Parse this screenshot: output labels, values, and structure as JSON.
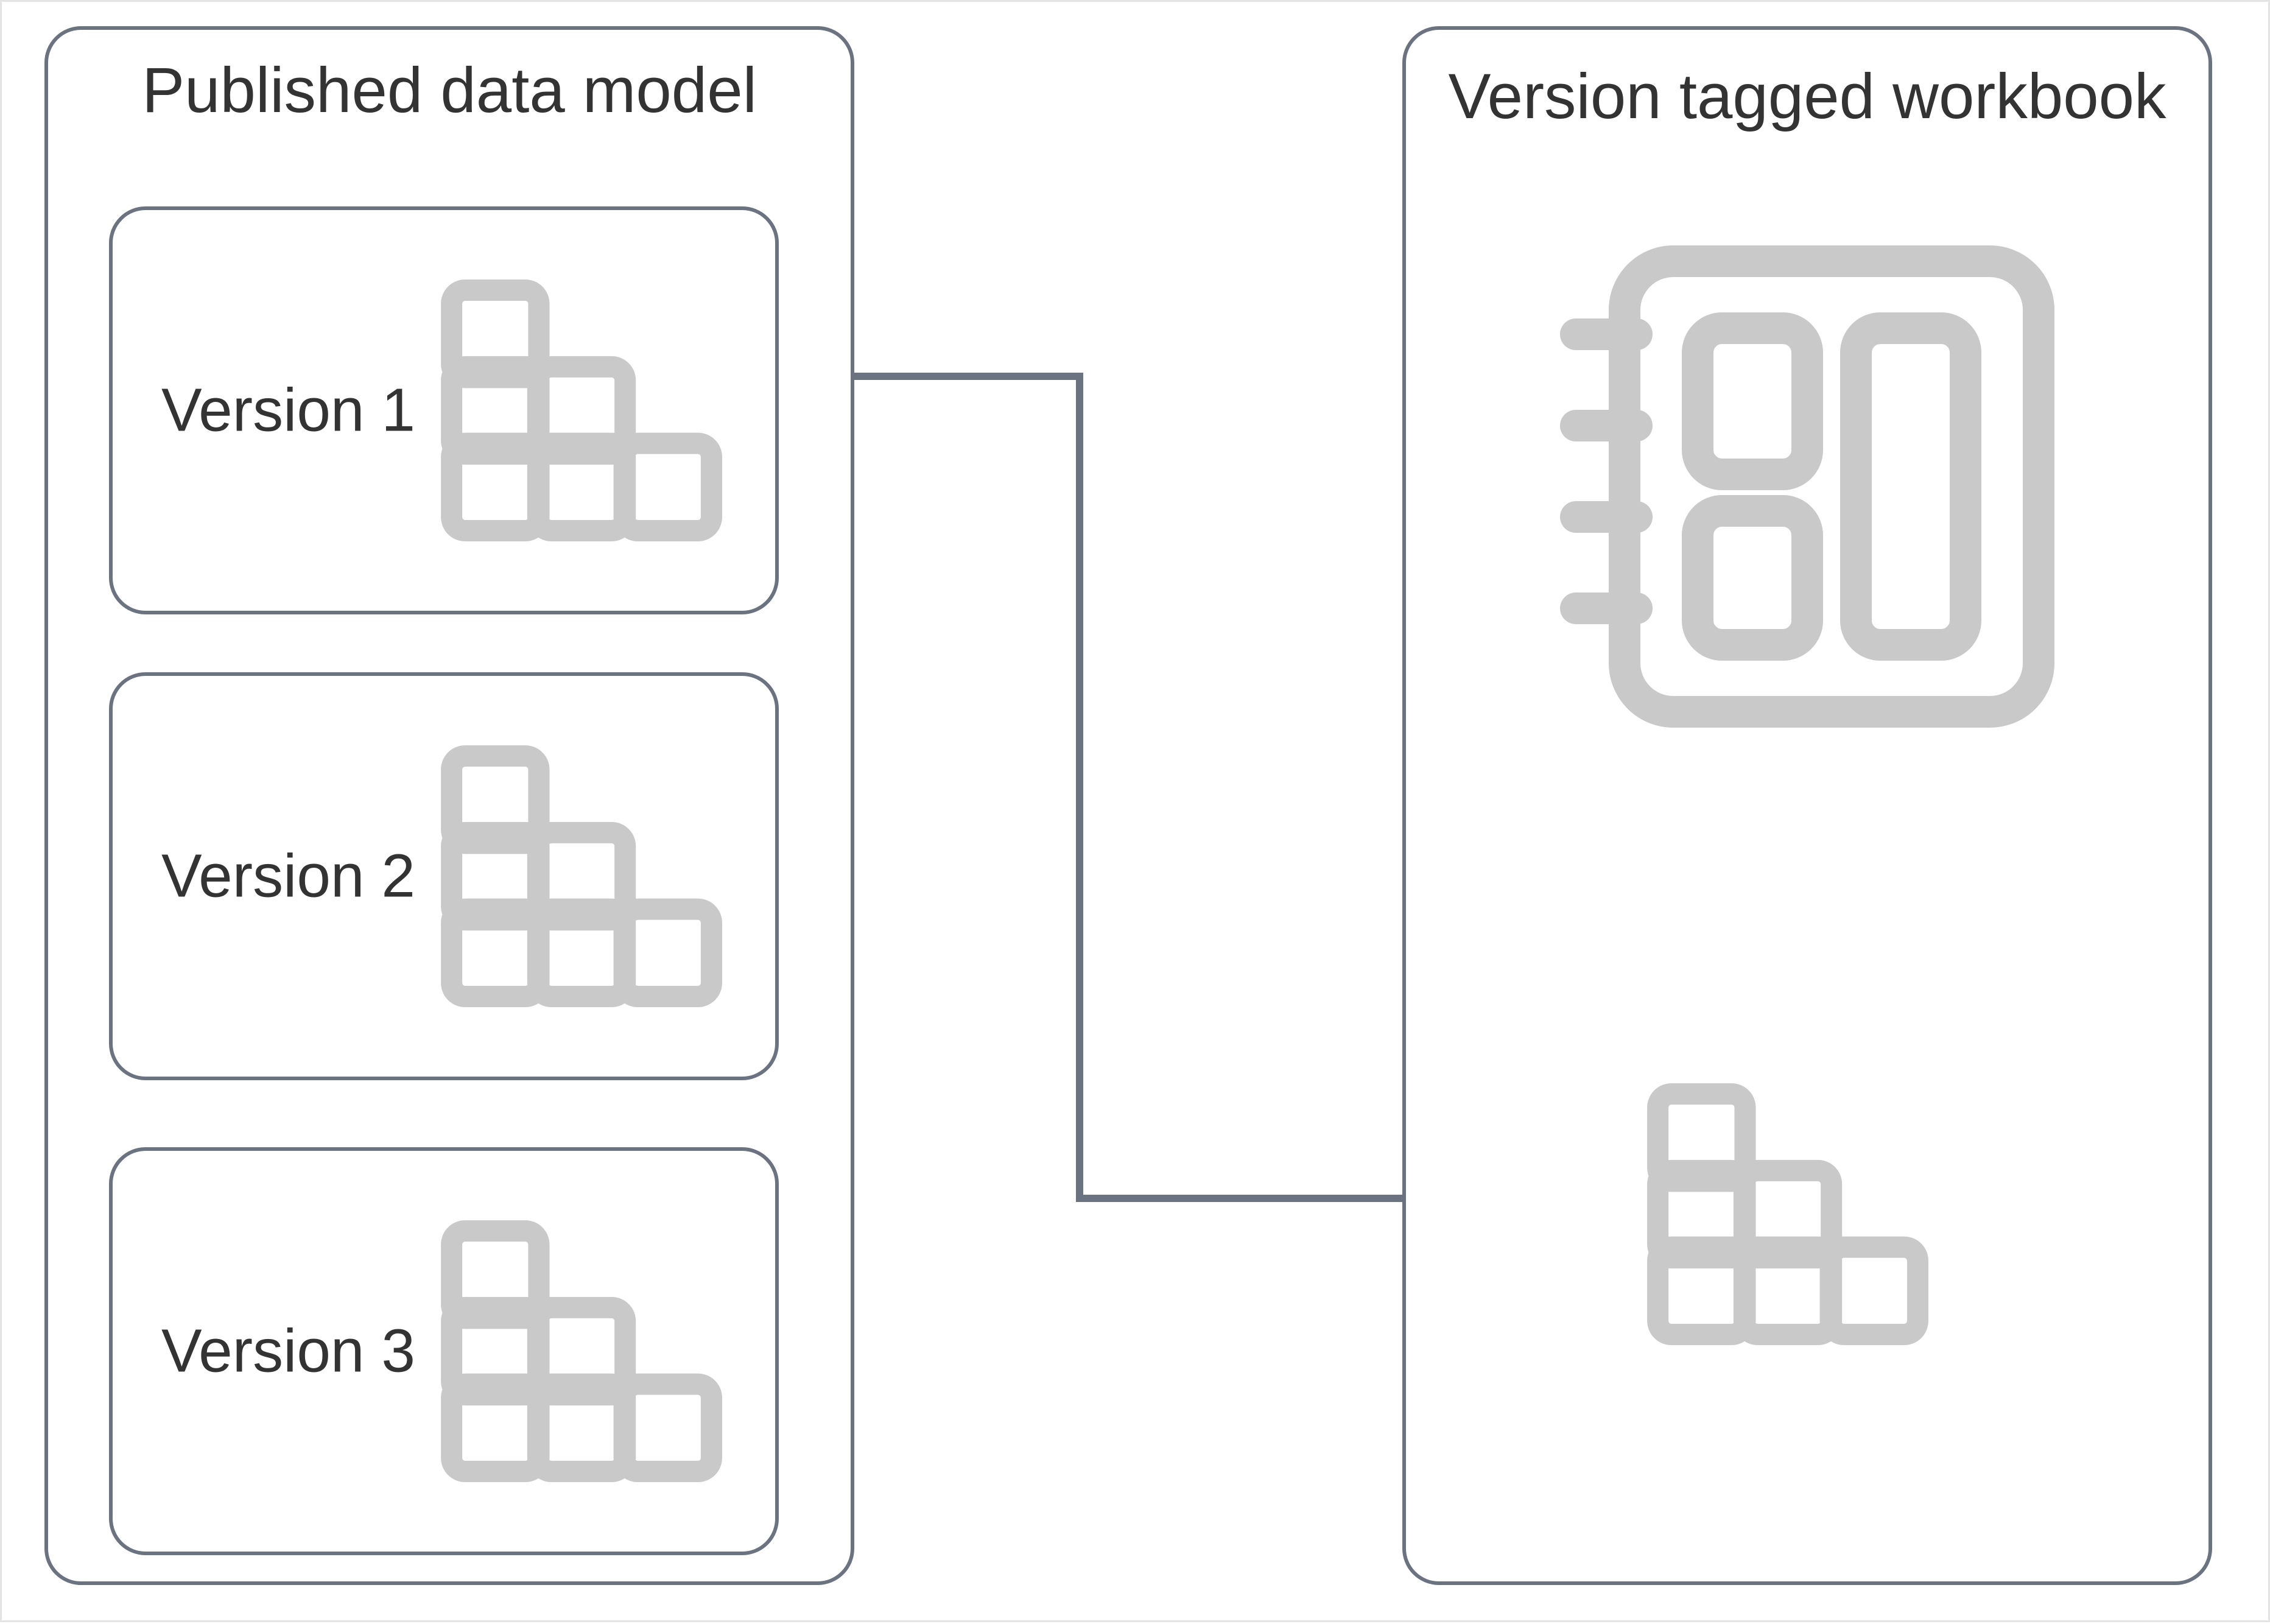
{
  "colors": {
    "border": "#6b7280",
    "iconStroke": "#c9c9c9",
    "text": "#333333",
    "canvasBorder": "#e4e4e4"
  },
  "left_panel": {
    "title": "Published data model",
    "versions": [
      {
        "label": "Version 1"
      },
      {
        "label": "Version 2"
      },
      {
        "label": "Version 3"
      }
    ]
  },
  "right_panel": {
    "title": "Version tagged workbook"
  },
  "icons": {
    "stair": "stair-blocks-icon",
    "notebook": "notebook-icon"
  },
  "connections": [
    {
      "from": "left-panel-version-2",
      "to": "right-panel-stair-icon"
    },
    {
      "from": "right-panel-stair-icon",
      "to": "right-panel-notebook-icon"
    }
  ]
}
